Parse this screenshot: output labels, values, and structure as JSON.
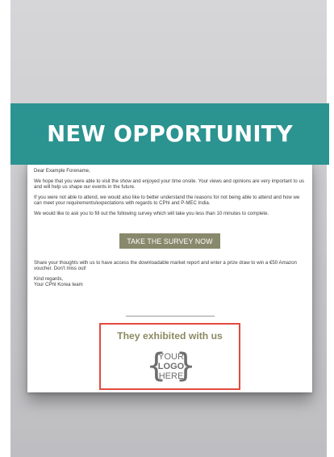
{
  "banner": {
    "title": "NEW OPPORTUNITY"
  },
  "email": {
    "greeting": "Dear Example Forename,",
    "paragraph_1": "We hope that you were able to visit the show and enjoyed your time onsite. Your views and opinions are very important to us and will help us shape our events in the future.",
    "paragraph_2": "If you were not able to attend,  we would also like to better understand the reasons for not being able to attend and how we can meet your requirements/expectations with regards to CPhI and P-MEC India.",
    "paragraph_3": "We would like to ask you to fill out the following survey which will take you less than 10 minutes to complete.",
    "cta_label": "TAKE THE SURVEY NOW",
    "paragraph_4": "Share your thoughts with us to have access the downloadable market report and enter a prize draw to win a €50 Amazon voucher. Don't miss out!",
    "signoff": "Kind regards,",
    "signature": "Your CPhI Korea team"
  },
  "exhibitor": {
    "title": "They exhibited with us",
    "logo_line_1": "YOUR",
    "logo_line_2": "LOGO",
    "logo_line_3": "HERE",
    "brace_left": "{",
    "brace_right": "}"
  },
  "colors": {
    "banner": "#2b9390",
    "cta": "#88886c",
    "highlight_border": "#e24a3e",
    "exhibitor_title": "#8a8a62"
  }
}
